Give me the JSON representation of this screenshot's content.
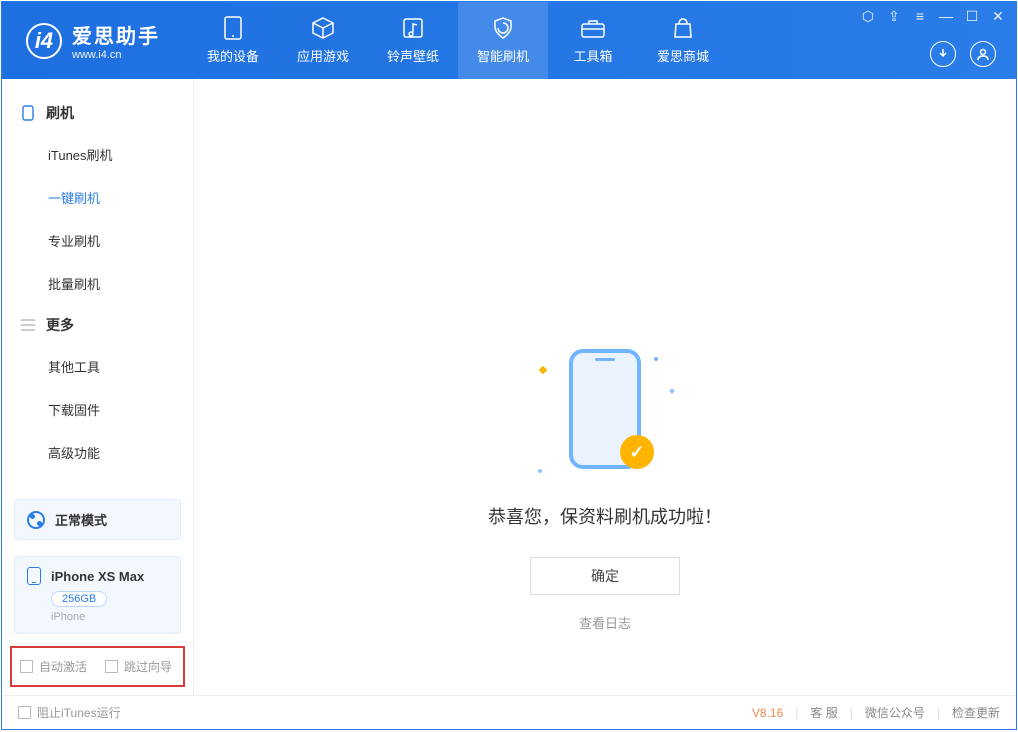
{
  "app": {
    "name_cn": "爱思助手",
    "name_en": "www.i4.cn"
  },
  "nav": {
    "device": "我的设备",
    "apps": "应用游戏",
    "ringtones": "铃声壁纸",
    "flash": "智能刷机",
    "toolbox": "工具箱",
    "store": "爱思商城"
  },
  "sidebar": {
    "group_flash": "刷机",
    "items_flash": {
      "itunes": "iTunes刷机",
      "one_click": "一键刷机",
      "pro": "专业刷机",
      "batch": "批量刷机"
    },
    "group_more": "更多",
    "items_more": {
      "other_tools": "其他工具",
      "download_fw": "下载固件",
      "advanced": "高级功能"
    }
  },
  "mode": {
    "label": "正常模式"
  },
  "device": {
    "name": "iPhone XS Max",
    "storage": "256GB",
    "type": "iPhone"
  },
  "options": {
    "auto_activate": "自动激活",
    "skip_guide": "跳过向导"
  },
  "main": {
    "success_msg": "恭喜您，保资料刷机成功啦！",
    "ok": "确定",
    "view_log": "查看日志"
  },
  "status": {
    "block_itunes": "阻止iTunes运行",
    "version": "V8.16",
    "support": "客 服",
    "wechat": "微信公众号",
    "update": "检查更新"
  }
}
